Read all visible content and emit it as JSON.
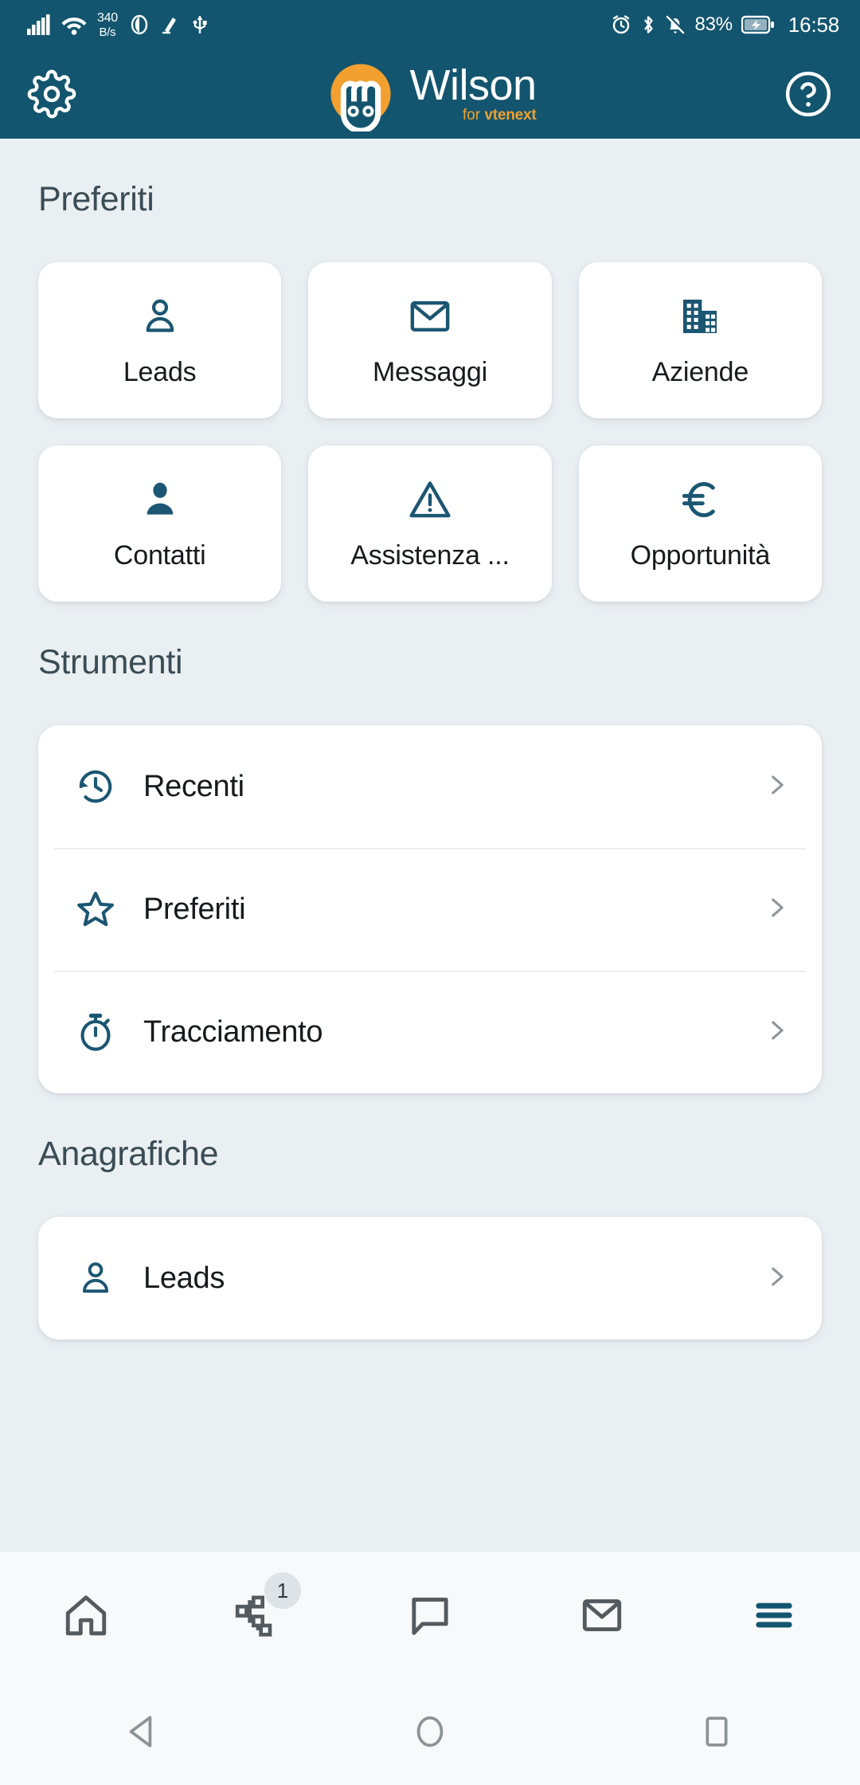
{
  "status_bar": {
    "network_speed_value": "340",
    "network_speed_unit": "B/s",
    "battery_percent": "83%",
    "time": "16:58",
    "icons": [
      "signal-icon",
      "wifi-icon",
      "eye-comfort-icon",
      "mute-icon",
      "usb-icon",
      "alarm-icon",
      "bluetooth-icon",
      "notification-off-icon",
      "battery-charging-icon"
    ]
  },
  "header": {
    "settings_label": "Impostazioni",
    "help_label": "Aiuto",
    "logo_name": "Wilson",
    "logo_for": "for",
    "logo_brand": "vtenext"
  },
  "favorites": {
    "title": "Preferiti",
    "cards": [
      {
        "label": "Leads",
        "icon": "person-outline-icon"
      },
      {
        "label": "Messaggi",
        "icon": "envelope-icon"
      },
      {
        "label": "Aziende",
        "icon": "building-icon"
      },
      {
        "label": "Contatti",
        "icon": "person-filled-icon"
      },
      {
        "label": "Assistenza ...",
        "icon": "warning-triangle-icon"
      },
      {
        "label": "Opportunità",
        "icon": "euro-icon"
      }
    ]
  },
  "tools": {
    "title": "Strumenti",
    "items": [
      {
        "label": "Recenti",
        "icon": "history-clock-icon"
      },
      {
        "label": "Preferiti",
        "icon": "star-outline-icon"
      },
      {
        "label": "Tracciamento",
        "icon": "stopwatch-icon"
      }
    ]
  },
  "records": {
    "title": "Anagrafiche",
    "items": [
      {
        "label": "Leads",
        "icon": "person-outline-icon"
      }
    ]
  },
  "bottom_nav": {
    "items": [
      {
        "name": "home",
        "icon": "home-icon",
        "badge": ""
      },
      {
        "name": "processes",
        "icon": "workflow-icon",
        "badge": "1"
      },
      {
        "name": "chat",
        "icon": "chat-bubble-icon",
        "badge": ""
      },
      {
        "name": "mail",
        "icon": "envelope-icon",
        "badge": ""
      },
      {
        "name": "menu",
        "icon": "hamburger-menu-icon",
        "badge": ""
      }
    ],
    "active": "menu"
  },
  "system_nav": {
    "back": "back-button",
    "home": "home-button",
    "recents": "recents-button"
  },
  "colors": {
    "brand_dark": "#13556e",
    "brand_orange": "#f2a030",
    "page_bg": "#eaeff2",
    "card_bg": "#ffffff",
    "title_text": "#3a4c55"
  }
}
